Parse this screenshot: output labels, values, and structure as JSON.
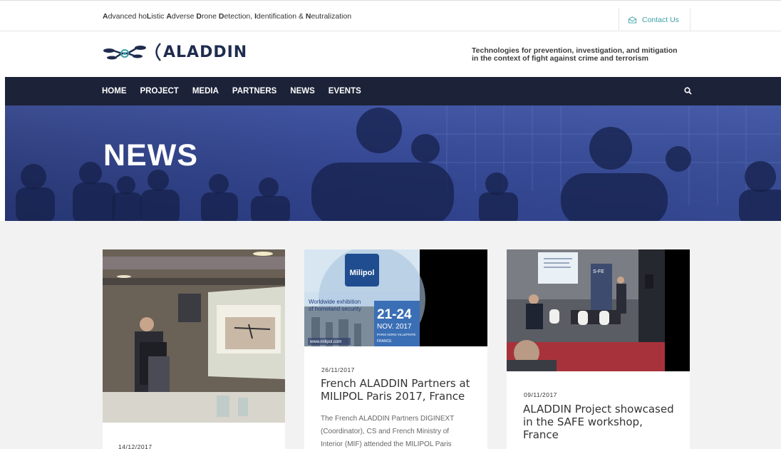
{
  "topbar": {
    "tagline_parts": [
      {
        "b": "A",
        "t": "dvanced ho"
      },
      {
        "b": "L",
        "t": "istic "
      },
      {
        "b": "A",
        "t": "dverse "
      },
      {
        "b": "D",
        "t": "rone "
      },
      {
        "b": "D",
        "t": "etection, "
      },
      {
        "b": "I",
        "t": "dentification & "
      },
      {
        "b": "N",
        "t": "eutralization"
      }
    ],
    "contact_label": "Contact Us",
    "contact_icon": "envelope-icon"
  },
  "header": {
    "brand": "ALADDIN",
    "slogan_line1": "Technologies for prevention, investigation, and mitigation",
    "slogan_line2": "in the context of fight against crime and terrorism"
  },
  "nav": {
    "items": [
      "HOME",
      "PROJECT",
      "MEDIA",
      "PARTNERS",
      "NEWS",
      "EVENTS"
    ],
    "search_icon": "search-icon"
  },
  "hero": {
    "title": "NEWS"
  },
  "posts": [
    {
      "date": "14/12/2017",
      "title": "",
      "excerpt": ""
    },
    {
      "date": "26/11/2017",
      "title": "French ALADDIN Partners at MILIPOL Paris 2017, France",
      "excerpt_lines": [
        "The French ALADDIN Partners DIGINEXT",
        "(Coordinator), CS and French Ministry of",
        "Interior (MIF) attended the MILIPOL Paris"
      ],
      "image": {
        "brand": "Milipol",
        "tag1": "Worldwide exhibition",
        "tag2": "of homeland security",
        "dates": "21-24",
        "month": "NOV. 2017",
        "venue": "PARIS NORD VILLEPINTE",
        "country": "FRANCE",
        "url": "www.milipol.com"
      }
    },
    {
      "date": "09/11/2017",
      "title": "ALADDIN Project showcased in the SAFE workshop, France",
      "excerpt": "",
      "image": {
        "screen_label": "S-FE"
      }
    }
  ],
  "colors": {
    "navy": "#1c2238",
    "brand": "#1f2c4f",
    "accent": "#3aa0a6",
    "hero": "#34489a",
    "bg": "#f2f2f2"
  }
}
